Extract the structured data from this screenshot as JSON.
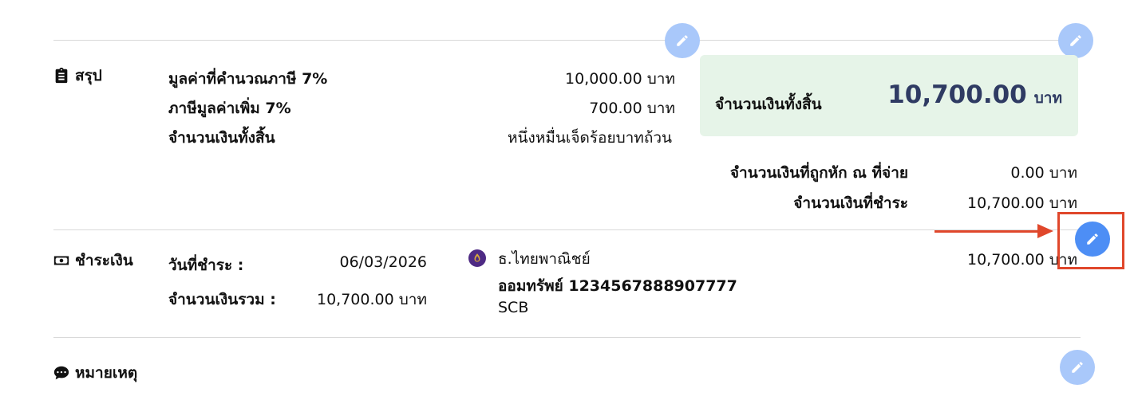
{
  "summary": {
    "title": "สรุป",
    "icon": "clipboard-icon",
    "taxable_label": "มูลค่าที่คำนวณภาษี 7%",
    "taxable_value": "10,000.00 บาท",
    "vat_label": "ภาษีมูลค่าเพิ่ม 7%",
    "vat_value": "700.00 บาท",
    "total_label": "จำนวนเงินทั้งสิ้น",
    "total_words": "หนึ่งหมื่นเจ็ดร้อยบาทถ้วน",
    "total_box_label": "จำนวนเงินทั้งสิ้น",
    "total_box_value": "10,700.00",
    "total_box_unit": "บาท",
    "withholding_label": "จำนวนเงินที่ถูกหัก ณ ที่จ่าย",
    "withholding_value": "0.00 บาท",
    "payable_label": "จำนวนเงินที่ชำระ",
    "payable_value": "10,700.00 บาท"
  },
  "payment": {
    "title": "ชำระเงิน",
    "icon": "money-icon",
    "date_label": "วันที่ชำระ :",
    "date_value": "06/03/2026",
    "amount_label": "จำนวนเงินรวม :",
    "amount_value": "10,700.00 บาท",
    "bank_name": "ธ.ไทยพาณิชย์",
    "bank_account": "ออมทรัพย์ 1234567888907777",
    "bank_code": "SCB",
    "bank_icon": "scb-logo-icon",
    "paid_amount": "10,700.00 บาท"
  },
  "notes": {
    "title": "หมายเหตุ",
    "icon": "chat-bubble-icon"
  },
  "colors": {
    "accent": "#4d8ef5",
    "accent_faded": "#a9c8fa",
    "total_box_bg": "#e6f4e8",
    "highlight": "#e0472b",
    "total_amount": "#2f3b63"
  }
}
